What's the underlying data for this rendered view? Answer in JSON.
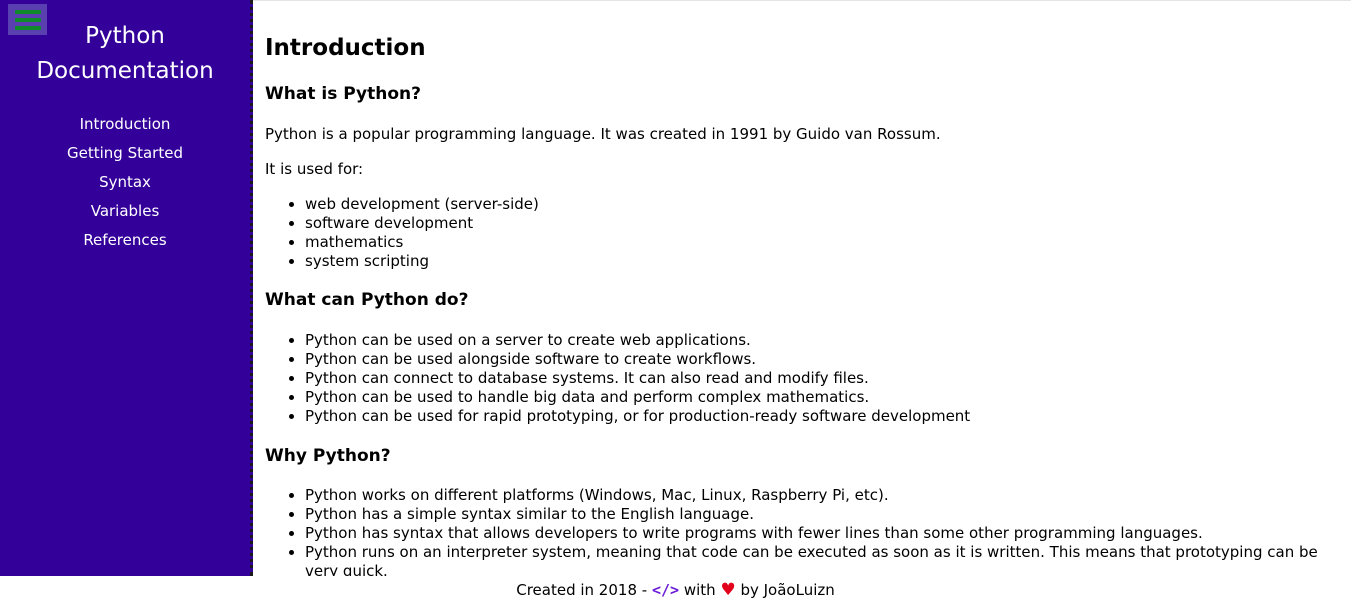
{
  "sidebar": {
    "title_line1": "Python",
    "title_line2": "Documentation",
    "nav": [
      {
        "label": "Introduction"
      },
      {
        "label": "Getting Started"
      },
      {
        "label": "Syntax"
      },
      {
        "label": "Variables"
      },
      {
        "label": "References"
      }
    ]
  },
  "main": {
    "title": "Introduction",
    "what_is": {
      "heading": "What is Python?",
      "p1": "Python is a popular programming language. It was created in 1991 by Guido van Rossum.",
      "p2": "It is used for:",
      "items": [
        "web development (server-side)",
        "software development",
        "mathematics",
        "system scripting"
      ]
    },
    "what_can": {
      "heading": "What can Python do?",
      "items": [
        "Python can be used on a server to create web applications.",
        "Python can be used alongside software to create workflows.",
        "Python can connect to database systems. It can also read and modify files.",
        "Python can be used to handle big data and perform complex mathematics.",
        "Python can be used for rapid prototyping, or for production-ready software development"
      ]
    },
    "why": {
      "heading": "Why Python?",
      "items": [
        "Python works on different platforms (Windows, Mac, Linux, Raspberry Pi, etc).",
        "Python has a simple syntax similar to the English language.",
        "Python has syntax that allows developers to write programs with fewer lines than some other programming languages.",
        "Python runs on an interpreter system, meaning that code can be executed as soon as it is written. This means that prototyping can be very quick."
      ]
    }
  },
  "footer": {
    "created": "Created in 2018 -",
    "code_icon": "</>",
    "with": "with",
    "heart_icon": "♥",
    "by": "by JoãoLuizn"
  },
  "colors": {
    "sidebar_bg": "#330099",
    "toggle_bg": "#5a3fb0",
    "toggle_bars": "#0f8a2a",
    "code_icon": "#6a1bd8",
    "heart_icon": "#e3001b"
  }
}
